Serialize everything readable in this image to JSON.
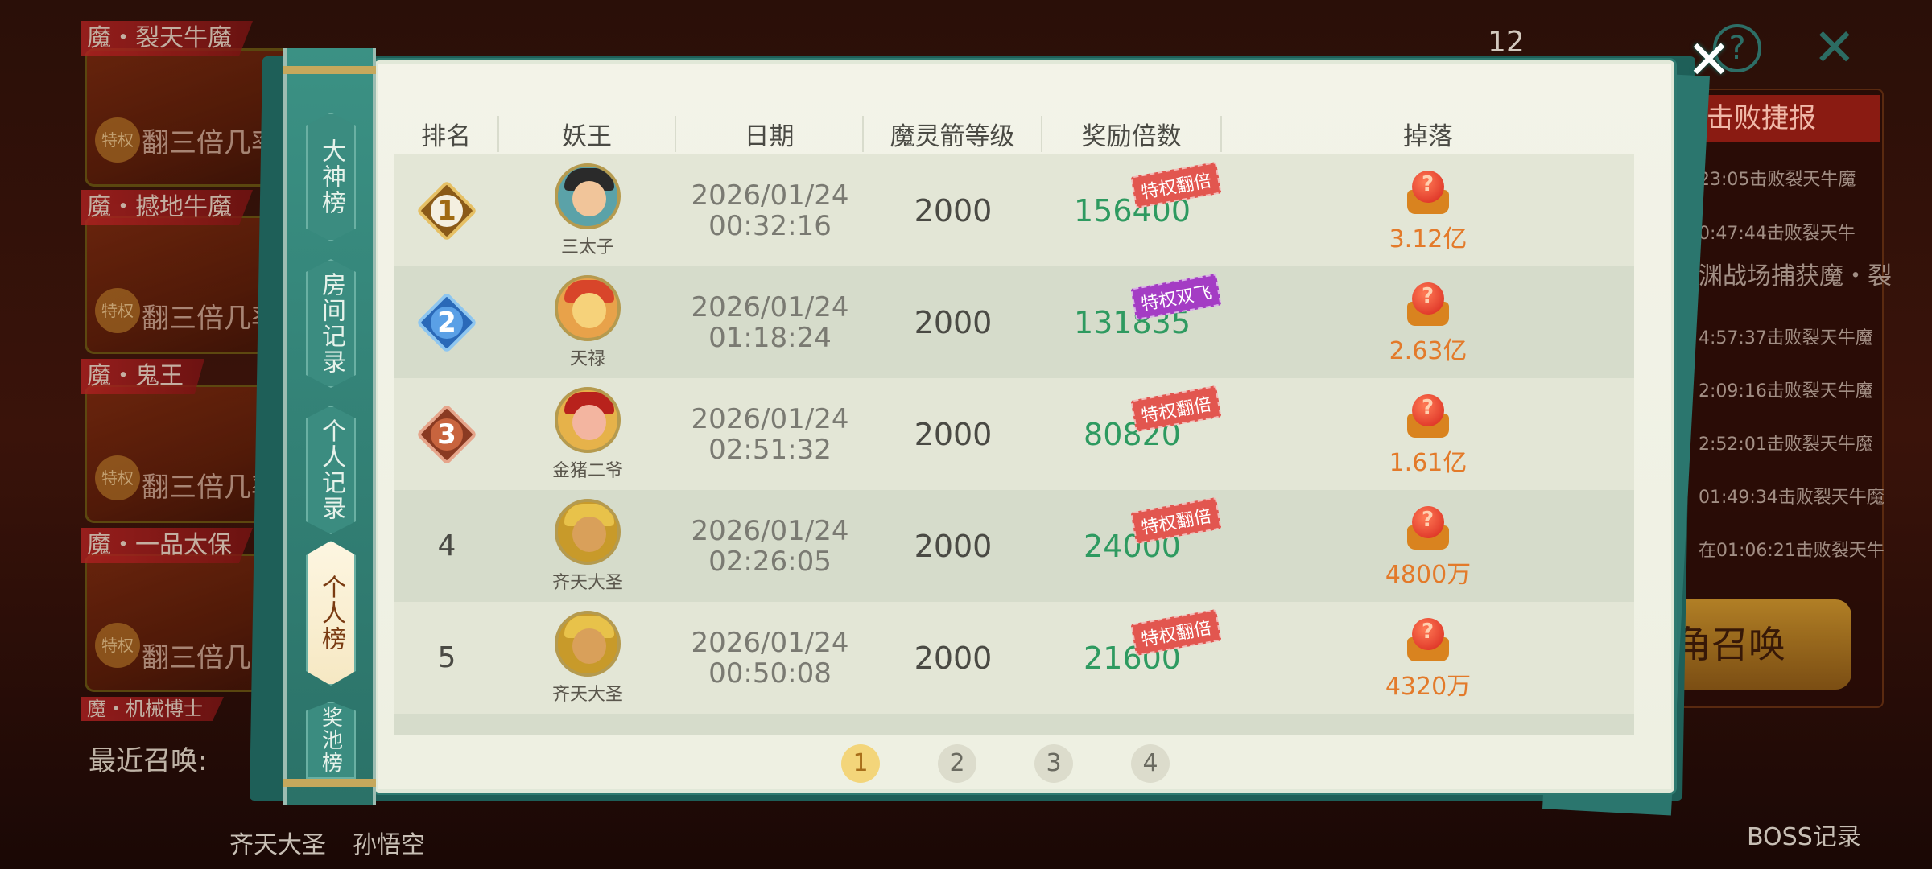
{
  "background": {
    "cards": [
      {
        "title": "魔・裂天牛魔",
        "sub": "翻三倍几率"
      },
      {
        "title": "魔・撼地牛魔",
        "sub": "翻三倍几率"
      },
      {
        "title": "魔・鬼王",
        "sub": "翻三倍几率"
      },
      {
        "title": "魔・一品太保",
        "sub": "翻三倍几率"
      }
    ],
    "card_badge": "特权",
    "card_partial": "魔・机械博士",
    "recent_label": "最近召唤:",
    "recent_heroes": [
      "齐天大圣",
      "孙悟空"
    ],
    "top_number": "12",
    "right_panel": {
      "title": "击败捷报",
      "lines": [
        "23:05击败裂天牛魔",
        "0:47:44击败裂天牛",
        "渊战场捕获魔・裂",
        "4:57:37击败裂天牛魔",
        "2:09:16击败裂天牛魔",
        "2:52:01击败裂天牛魔",
        "01:49:34击败裂天牛魔",
        "在01:06:21击败裂天牛"
      ],
      "summon_button": "角召唤",
      "boss_record": "BOSS记录"
    }
  },
  "modal": {
    "tabs": [
      {
        "label": "大神榜",
        "active": false
      },
      {
        "label": "房间记录",
        "active": false
      },
      {
        "label": "个人记录",
        "active": false
      },
      {
        "label": "个人榜",
        "active": true
      },
      {
        "label": "奖池榜",
        "active": false
      }
    ],
    "close_icon": "close-icon",
    "columns": {
      "rank": "排名",
      "king": "妖王",
      "date": "日期",
      "level": "魔灵箭等级",
      "multiplier": "奖励倍数",
      "drop": "掉落"
    },
    "rows": [
      {
        "rank": "1",
        "king": "三太子",
        "date": "2026/01/24",
        "time": "00:32:16",
        "level": "2000",
        "multiplier": "156400",
        "tag": "特权翻倍",
        "tag_color": "#e2564f",
        "drop": "3.12亿"
      },
      {
        "rank": "2",
        "king": "天禄",
        "date": "2026/01/24",
        "time": "01:18:24",
        "level": "2000",
        "multiplier": "131835",
        "tag": "特权双飞",
        "tag_color": "#a43cc4",
        "drop": "2.63亿"
      },
      {
        "rank": "3",
        "king": "金猪二爷",
        "date": "2026/01/24",
        "time": "02:51:32",
        "level": "2000",
        "multiplier": "80820",
        "tag": "特权翻倍",
        "tag_color": "#e2564f",
        "drop": "1.61亿"
      },
      {
        "rank": "4",
        "king": "齐天大圣",
        "date": "2026/01/24",
        "time": "02:26:05",
        "level": "2000",
        "multiplier": "24000",
        "tag": "特权翻倍",
        "tag_color": "#e2564f",
        "drop": "4800万"
      },
      {
        "rank": "5",
        "king": "齐天大圣",
        "date": "2026/01/24",
        "time": "00:50:08",
        "level": "2000",
        "multiplier": "21600",
        "tag": "特权翻倍",
        "tag_color": "#e2564f",
        "drop": "4320万"
      }
    ],
    "pages": [
      "1",
      "2",
      "3",
      "4"
    ],
    "current_page": "1"
  },
  "colors": {
    "accent_teal": "#2e7a70",
    "multiplier_green": "#2e9a60",
    "drop_orange": "#e37a2a",
    "rank1": "#c9962c",
    "rank2": "#3a7fd0",
    "rank3": "#b55a3a"
  }
}
